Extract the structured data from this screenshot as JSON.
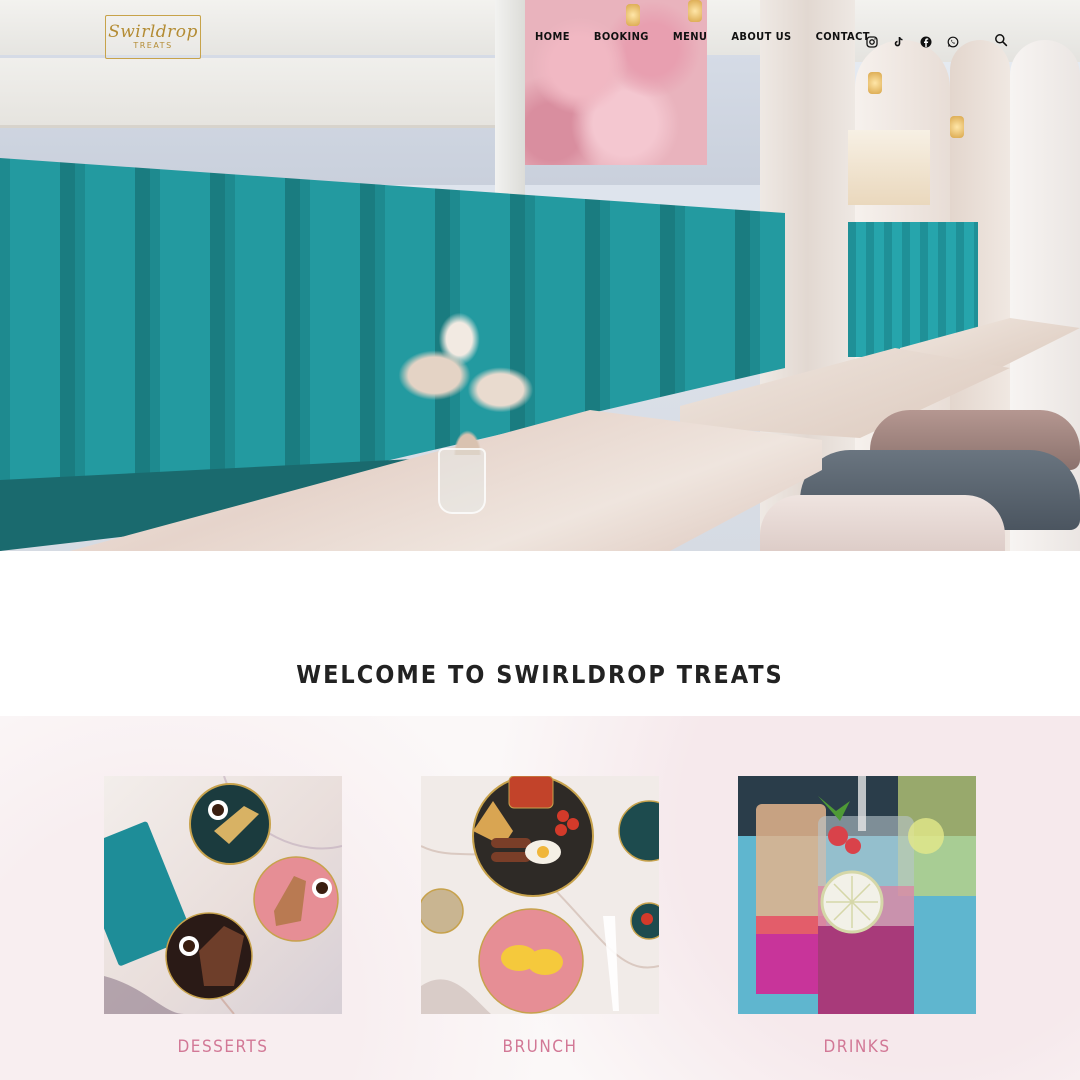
{
  "brand": {
    "logo_line1": "Swirldrop",
    "logo_line2": "TREATS"
  },
  "nav": {
    "items": [
      {
        "label": "HOME"
      },
      {
        "label": "BOOKING"
      },
      {
        "label": "MENU"
      },
      {
        "label": "ABOUT US"
      },
      {
        "label": "CONTACT"
      }
    ],
    "social_icons": [
      "instagram-icon",
      "tiktok-icon",
      "facebook-icon",
      "whatsapp-icon"
    ],
    "search_icon": "search-icon"
  },
  "welcome": {
    "heading": "WELCOME TO SWIRLDROP TREATS"
  },
  "categories": [
    {
      "label": "DESSERTS"
    },
    {
      "label": "BRUNCH"
    },
    {
      "label": "DRINKS"
    }
  ],
  "colors": {
    "accent_pink": "#d27896",
    "teal": "#1e8a8f",
    "logo_gold": "#b48c34"
  }
}
